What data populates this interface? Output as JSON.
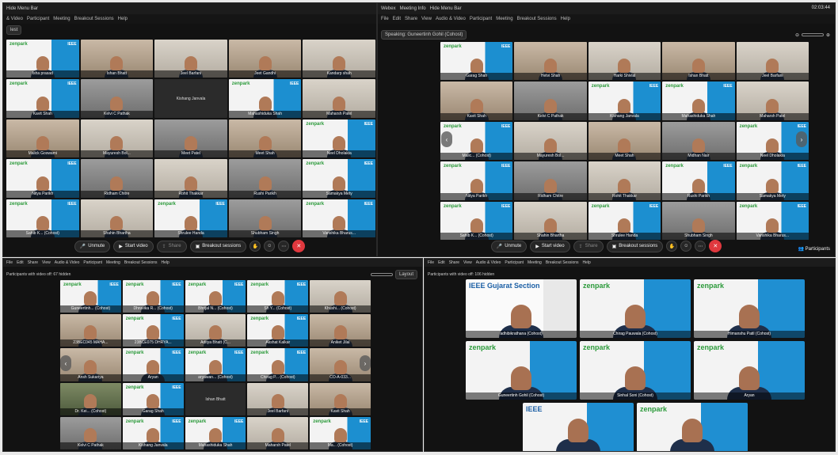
{
  "top_left": {
    "menu": [
      "Hide Menu Bar"
    ],
    "menu2": [
      "& Video",
      "Participant",
      "Meeting",
      "Breakout Sessions",
      "Help"
    ],
    "info_label": "lest",
    "tiles": [
      {
        "name": "Isha prasad",
        "style": "brand"
      },
      {
        "name": "Ishan Bhatt",
        "style": "warm"
      },
      {
        "name": "Jeel Barfani",
        "style": "pale"
      },
      {
        "name": "Jeet Gandhi",
        "style": "warm"
      },
      {
        "name": "Kandarp shah",
        "style": "pale"
      },
      {
        "name": "Kavit Shah",
        "style": "brand"
      },
      {
        "name": "Kelvi C Pathak",
        "style": "gray"
      },
      {
        "name": "",
        "style": "dark",
        "center": "Kishang Janvala"
      },
      {
        "name": "Mahashiduka Shah",
        "style": "brand"
      },
      {
        "name": "Maharsh Patel",
        "style": "pale"
      },
      {
        "name": "Malick Goswami",
        "style": "warm"
      },
      {
        "name": "Mayuresh Bol...",
        "style": "pale"
      },
      {
        "name": "Meet Patel",
        "style": "gray"
      },
      {
        "name": "Meet Shah",
        "style": "warm"
      },
      {
        "name": "Neel Dholakia",
        "style": "brand"
      },
      {
        "name": "Nitya Parikh",
        "style": "brand"
      },
      {
        "name": "Ridham Chitre",
        "style": "gray"
      },
      {
        "name": "Rohit Thakkar",
        "style": "pale"
      },
      {
        "name": "Rushi Parikh",
        "style": "gray"
      },
      {
        "name": "Samakya Mety",
        "style": "brand"
      },
      {
        "name": "Sahib K... (Cohost)",
        "style": "brand"
      },
      {
        "name": "Shahin Bhartha",
        "style": "pale"
      },
      {
        "name": "Shrulee Handa",
        "style": "brand"
      },
      {
        "name": "Shubham Singh",
        "style": "gray"
      },
      {
        "name": "Vanshika Bharus...",
        "style": "brand"
      }
    ],
    "toolbar": {
      "unmute": "Unmute",
      "start_video": "Start video",
      "share": "Share",
      "breakout": "Breakout sessions"
    }
  },
  "top_right": {
    "menu": [
      "Webex",
      "Meeting Info",
      "Hide Menu Bar"
    ],
    "clock": "02:03:44",
    "menu2": [
      "File",
      "Edit",
      "Share",
      "View",
      "Audio & Video",
      "Participant",
      "Meeting",
      "Breakout Sessions",
      "Help"
    ],
    "speaking": "Speaking: Guneertinh Gohil (Cohost)",
    "tiles": [
      {
        "name": "Garag Shah",
        "style": "brand"
      },
      {
        "name": "Hetvi Shah",
        "style": "warm"
      },
      {
        "name": "Harki Shivlal",
        "style": "pale"
      },
      {
        "name": "Ishan Bhatt",
        "style": "warm"
      },
      {
        "name": "Jeel Barfani",
        "style": "pale"
      },
      {
        "name": "Kavit Shah",
        "style": "warm"
      },
      {
        "name": "Kelvi C Pathak",
        "style": "gray"
      },
      {
        "name": "Kishang Janvala",
        "style": "brand"
      },
      {
        "name": "Mahashiduka Shah",
        "style": "brand"
      },
      {
        "name": "Maharsh Patel",
        "style": "pale"
      },
      {
        "name": "Malic... (Cohost)",
        "style": "brand"
      },
      {
        "name": "Mayuresh Bol...",
        "style": "pale"
      },
      {
        "name": "Meet Shah",
        "style": "warm"
      },
      {
        "name": "Midhan Nair",
        "style": "gray"
      },
      {
        "name": "Neel Dholakia",
        "style": "brand"
      },
      {
        "name": "Nitya Parikh",
        "style": "brand"
      },
      {
        "name": "Ridham Chitre",
        "style": "gray"
      },
      {
        "name": "Rohit Thakkar",
        "style": "pale"
      },
      {
        "name": "Rushi Parikh",
        "style": "brand"
      },
      {
        "name": "Samakya Mety",
        "style": "brand"
      },
      {
        "name": "Sahib K... (Cohost)",
        "style": "brand"
      },
      {
        "name": "Shahin Bhartha",
        "style": "pale"
      },
      {
        "name": "Shrulee Handa",
        "style": "brand"
      },
      {
        "name": "Shubham Singh",
        "style": "gray"
      },
      {
        "name": "Vanshika Bharus...",
        "style": "brand"
      }
    ],
    "toolbar": {
      "unmute": "Unmute",
      "start_video": "Start video",
      "share": "Share",
      "breakout": "Breakout sessions",
      "participants": "Participants"
    }
  },
  "bottom_left": {
    "menu": [
      "File",
      "Edit",
      "Share",
      "View",
      "Audio & Video",
      "Participant",
      "Meeting",
      "Breakout Sessions",
      "Help"
    ],
    "info": "Participants with video off: 67 hidden",
    "layout": "Layout",
    "tiles": [
      {
        "name": "Guneertinh... (Cohost)",
        "style": "brand"
      },
      {
        "name": "Dhruvika R... (Cohost)",
        "style": "brand"
      },
      {
        "name": "Bhrijal N... (Cohost)",
        "style": "brand"
      },
      {
        "name": "Sh Y... (Cohost)",
        "style": "brand"
      },
      {
        "name": "Khushi... (Cohost)",
        "style": "pale"
      },
      {
        "name": "23BEC045 MAHA...",
        "style": "warm"
      },
      {
        "name": "23BCE075 DHRYA...",
        "style": "brand"
      },
      {
        "name": "Aditya Bhatt (C...",
        "style": "pale"
      },
      {
        "name": "Akshat Kalkar",
        "style": "brand"
      },
      {
        "name": "Aniket Jilal",
        "style": "warm"
      },
      {
        "name": "Ansh Sukariya",
        "style": "warm"
      },
      {
        "name": "Aryan",
        "style": "brand"
      },
      {
        "name": "aryawan... (Cohost)",
        "style": "brand"
      },
      {
        "name": "Chirag P... (Cohost)",
        "style": "brand"
      },
      {
        "name": "CO-A-033...",
        "style": "warm"
      },
      {
        "name": "Dr. Kei... (Cohost)",
        "style": "green"
      },
      {
        "name": "Garag Shah",
        "style": "brand"
      },
      {
        "name": "",
        "style": "dark",
        "center": "Ishan Bhatt"
      },
      {
        "name": "Jeel Barfani",
        "style": "pale"
      },
      {
        "name": "Kavit Shah",
        "style": "warm"
      },
      {
        "name": "Kelvi C Pathak",
        "style": "gray"
      },
      {
        "name": "Kishang Janvala",
        "style": "brand"
      },
      {
        "name": "Mahashiduka Shah",
        "style": "brand"
      },
      {
        "name": "Maharsh Patel",
        "style": "pale"
      },
      {
        "name": "Ma... (Cohost)",
        "style": "brand"
      }
    ]
  },
  "bottom_right": {
    "menu": [
      "File",
      "Edit",
      "Share",
      "View",
      "Audio & Video",
      "Participant",
      "Meeting",
      "Breakout Sessions",
      "Help"
    ],
    "info": "Participants with video off: 106 hidden",
    "tiles": [
      {
        "name": "adhibikrathana (Cohost)",
        "brand": "IEEE Gujarat Section"
      },
      {
        "name": "Chirag Pauwala (Cohost)",
        "brand": "zenpark"
      },
      {
        "name": "Himanshu Patil (Cohost)",
        "brand": "zenpark"
      },
      {
        "name": "Guneertinh Gohil (Cohost)",
        "brand": "zenpark"
      },
      {
        "name": "Sinhal Soni (Cohost)",
        "brand": "zenpark"
      },
      {
        "name": "Aryan",
        "brand": "zenpark"
      },
      {
        "name": "",
        "brand": "IEEE"
      },
      {
        "name": "",
        "brand": "zenpark"
      }
    ]
  }
}
